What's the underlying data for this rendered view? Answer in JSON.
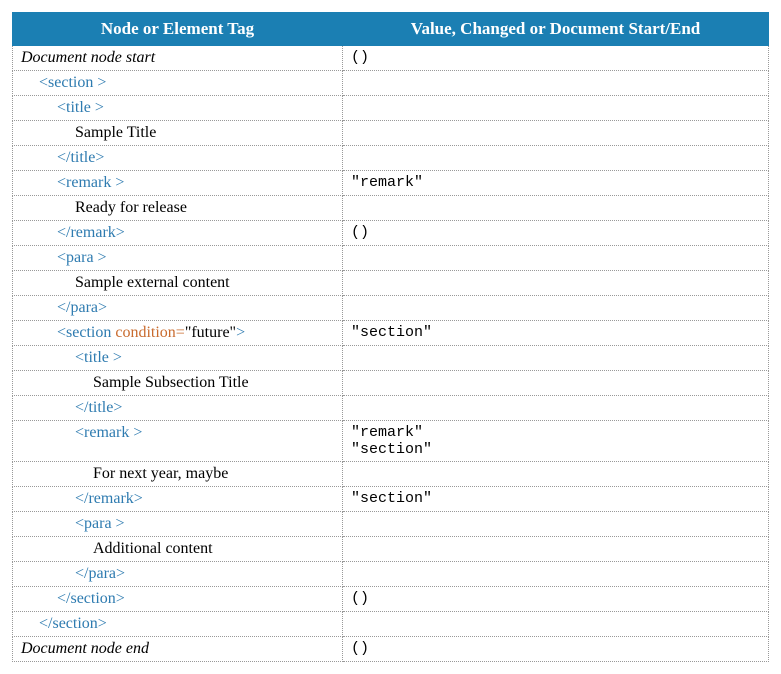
{
  "headers": {
    "col1": "Node or Element Tag",
    "col2": "Value, Changed or Document Start/End"
  },
  "rows": [
    {
      "left_html": "<span class='italic'>Document node start</span>",
      "right": "()"
    },
    {
      "left_html": "<span class='ind1 tag'>&lt;section &gt;</span>",
      "right": ""
    },
    {
      "left_html": "<span class='ind2 tag'>&lt;title &gt;</span>",
      "right": ""
    },
    {
      "left_html": "<span class='ind3'>Sample Title</span>",
      "right": ""
    },
    {
      "left_html": "<span class='ind2 tag'>&lt;/title&gt;</span>",
      "right": ""
    },
    {
      "left_html": "<span class='ind2 tag'>&lt;remark &gt;</span>",
      "right": "\"remark\""
    },
    {
      "left_html": "<span class='ind3'>Ready for release</span>",
      "right": ""
    },
    {
      "left_html": "<span class='ind2 tag'>&lt;/remark&gt;</span>",
      "right": "()"
    },
    {
      "left_html": "<span class='ind2 tag'>&lt;para &gt;</span>",
      "right": ""
    },
    {
      "left_html": "<span class='ind3'>Sample external content</span>",
      "right": ""
    },
    {
      "left_html": "<span class='ind2 tag'>&lt;/para&gt;</span>",
      "right": ""
    },
    {
      "left_html": "<span class='ind2'><span class='tag'>&lt;section </span><span class='attr'>condition=</span><span class='val'>\"future\"</span><span class='tag'>&gt;</span></span>",
      "right": "\"section\""
    },
    {
      "left_html": "<span class='ind3 tag'>&lt;title &gt;</span>",
      "right": ""
    },
    {
      "left_html": "<span class='ind3' style='padding-left:72px'>Sample Subsection Title</span>",
      "right": ""
    },
    {
      "left_html": "<span class='ind3 tag'>&lt;/title&gt;</span>",
      "right": ""
    },
    {
      "left_html": "<span class='ind3 tag'>&lt;remark &gt;</span>",
      "right": "\"remark\"\n\"section\""
    },
    {
      "left_html": "<span class='ind3' style='padding-left:72px'>For next year, maybe</span>",
      "right": ""
    },
    {
      "left_html": "<span class='ind3 tag'>&lt;/remark&gt;</span>",
      "right": "\"section\""
    },
    {
      "left_html": "<span class='ind3 tag'>&lt;para &gt;</span>",
      "right": ""
    },
    {
      "left_html": "<span class='ind3' style='padding-left:72px'>Additional content</span>",
      "right": ""
    },
    {
      "left_html": "<span class='ind3 tag'>&lt;/para&gt;</span>",
      "right": ""
    },
    {
      "left_html": "<span class='ind2 tag'>&lt;/section&gt;</span>",
      "right": "()"
    },
    {
      "left_html": "<span class='ind1 tag'>&lt;/section&gt;</span>",
      "right": ""
    },
    {
      "left_html": "<span class='italic'>Document node end</span>",
      "right": "()"
    }
  ]
}
